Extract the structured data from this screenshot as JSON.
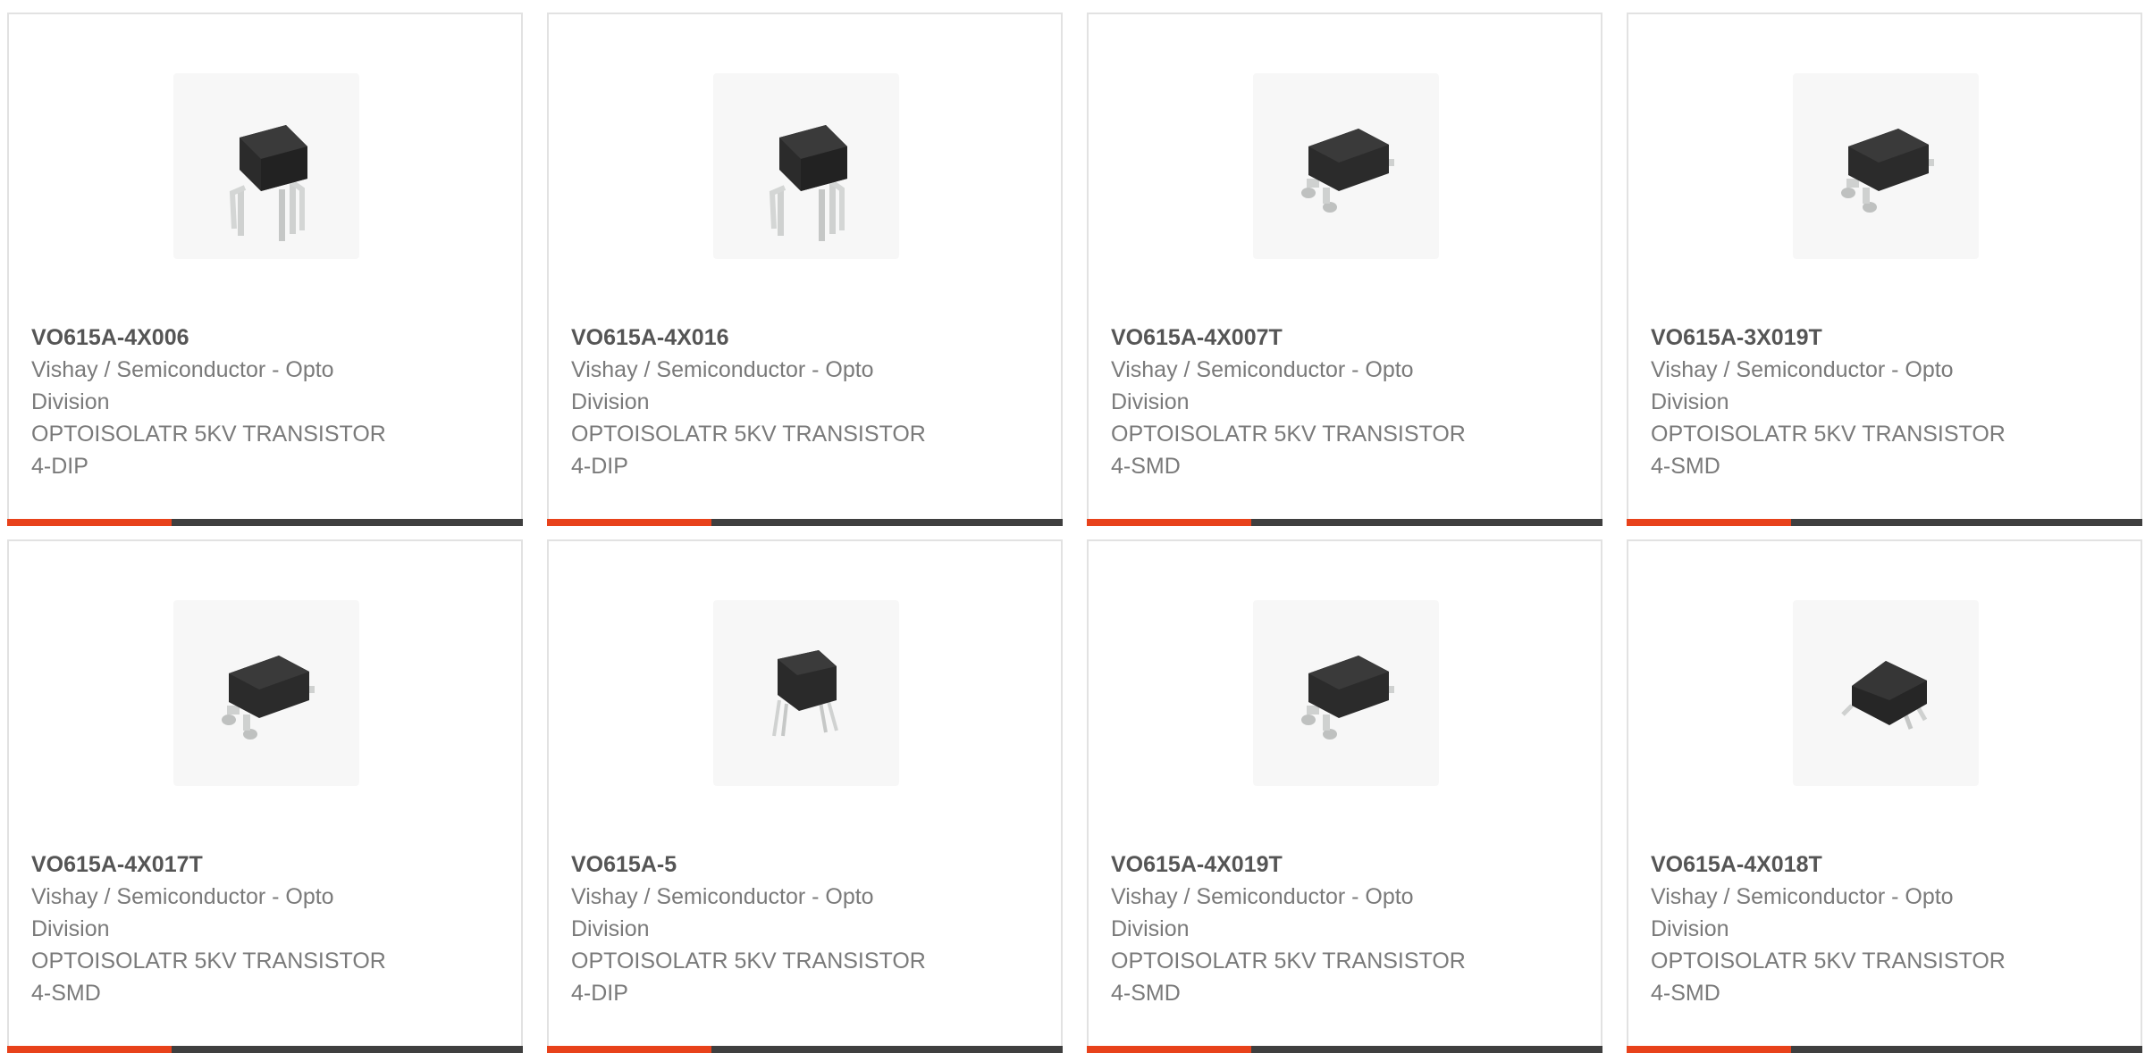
{
  "colors": {
    "accent": "#e8421b",
    "bar": "#3f3f3f",
    "border": "#e2e2e2",
    "text": "#7a7a7a",
    "title": "#555555"
  },
  "products": [
    {
      "part_number": "VO615A-4X006",
      "manufacturer": "Vishay / Semiconductor - Opto Division",
      "description": "OPTOISOLATR 5KV TRANSISTOR 4-DIP",
      "image_icon": "dip-optocoupler-icon",
      "package": "dip"
    },
    {
      "part_number": "VO615A-4X016",
      "manufacturer": "Vishay / Semiconductor - Opto Division",
      "description": "OPTOISOLATR 5KV TRANSISTOR 4-DIP",
      "image_icon": "dip-optocoupler-icon",
      "package": "dip"
    },
    {
      "part_number": "VO615A-4X007T",
      "manufacturer": "Vishay / Semiconductor - Opto Division",
      "description": "OPTOISOLATR 5KV TRANSISTOR 4-SMD",
      "image_icon": "smd-optocoupler-icon",
      "package": "smd"
    },
    {
      "part_number": "VO615A-3X019T",
      "manufacturer": "Vishay / Semiconductor - Opto Division",
      "description": "OPTOISOLATR 5KV TRANSISTOR 4-SMD",
      "image_icon": "smd-optocoupler-icon",
      "package": "smd"
    },
    {
      "part_number": "VO615A-4X017T",
      "manufacturer": "Vishay / Semiconductor - Opto Division",
      "description": "OPTOISOLATR 5KV TRANSISTOR 4-SMD",
      "image_icon": "smd-optocoupler-icon",
      "package": "smd"
    },
    {
      "part_number": "VO615A-5",
      "manufacturer": "Vishay / Semiconductor - Opto Division",
      "description": "OPTOISOLATR 5KV TRANSISTOR 4-DIP",
      "image_icon": "small-dip-optocoupler-icon",
      "package": "dip-small"
    },
    {
      "part_number": "VO615A-4X019T",
      "manufacturer": "Vishay / Semiconductor - Opto Division",
      "description": "OPTOISOLATR 5KV TRANSISTOR 4-SMD",
      "image_icon": "smd-optocoupler-icon",
      "package": "smd"
    },
    {
      "part_number": "VO615A-4X018T",
      "manufacturer": "Vishay / Semiconductor - Opto Division",
      "description": "OPTOISOLATR 5KV TRANSISTOR 4-SMD",
      "image_icon": "smd-optocoupler-icon",
      "package": "smd-side"
    }
  ]
}
